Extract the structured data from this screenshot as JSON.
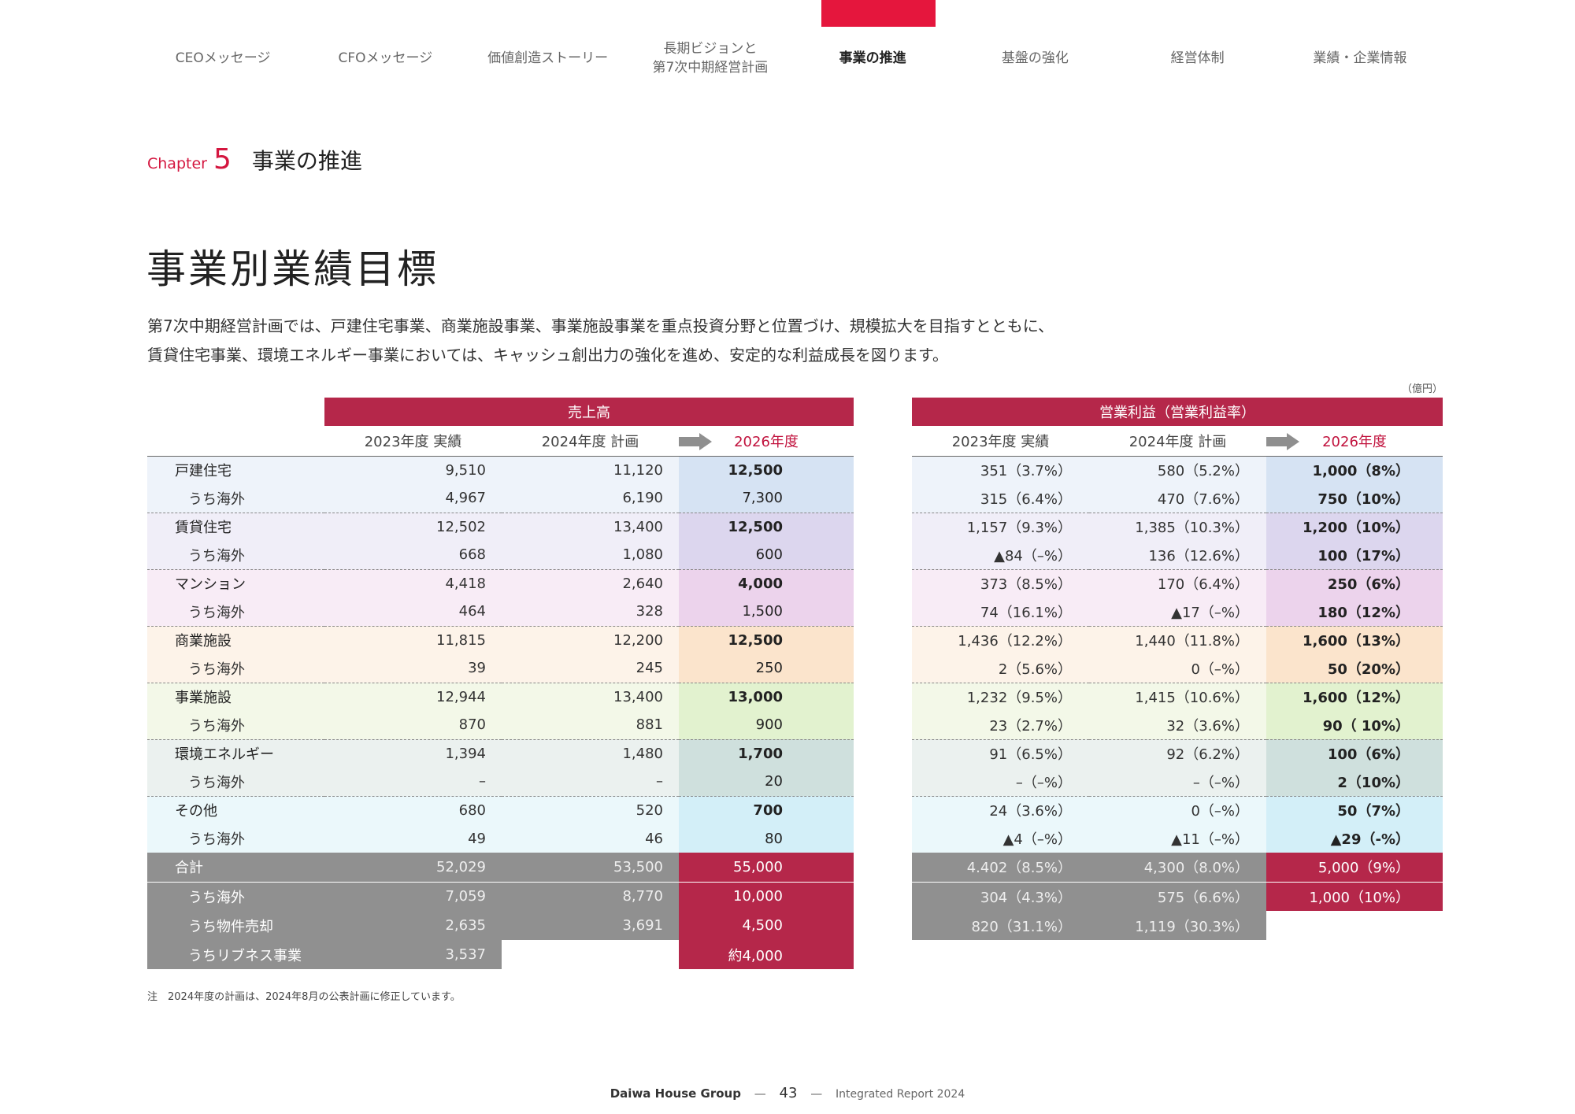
{
  "nav": {
    "items": [
      "CEOメッセージ",
      "CFOメッセージ",
      "価値創造ストーリー",
      "長期ビジョンと\n第7次中期経営計画",
      "事業の推進",
      "基盤の強化",
      "経営体制",
      "業績・企業情報"
    ],
    "active_index": 4,
    "active_color": "#e5163d"
  },
  "chapter": {
    "word": "Chapter",
    "number": "5",
    "title": "事業の推進"
  },
  "page_title": "事業別業績目標",
  "intro": [
    "第7次中期経営計画では、戸建住宅事業、商業施設事業、事業施設事業を重点投資分野と位置づけ、規模拡大を目指すとともに、",
    "賃貸住宅事業、環境エネルギー事業においては、キャッシュ創出力の強化を進め、安定的な利益成長を図ります。"
  ],
  "unit": "（億円）",
  "sales": {
    "header": "売上高",
    "cols": [
      "2023年度 実績",
      "2024年度 計画",
      "2026年度"
    ]
  },
  "profit": {
    "header": "営業利益（営業利益率）",
    "cols": [
      "2023年度 実績",
      "2024年度 計画",
      "2026年度"
    ]
  },
  "segments": [
    {
      "name": "戸建住宅",
      "sales": [
        "9,510",
        "11,120",
        "12,500"
      ],
      "profit": [
        "351（3.7%）",
        "580（5.2%）",
        "1,000（8%）"
      ],
      "sub": {
        "name": "うち海外",
        "sales": [
          "4,967",
          "6,190",
          "7,300"
        ],
        "profit": [
          "315（6.4%）",
          "470（7.6%）",
          "750（10%）"
        ]
      }
    },
    {
      "name": "賃貸住宅",
      "sales": [
        "12,502",
        "13,400",
        "12,500"
      ],
      "profit": [
        "1,157（9.3%）",
        "1,385（10.3%）",
        "1,200（10%）"
      ],
      "sub": {
        "name": "うち海外",
        "sales": [
          "668",
          "1,080",
          "600"
        ],
        "profit": [
          "▲84（–%）",
          "136（12.6%）",
          "100（17%）"
        ]
      }
    },
    {
      "name": "マンション",
      "sales": [
        "4,418",
        "2,640",
        "4,000"
      ],
      "profit": [
        "373（8.5%）",
        "170（6.4%）",
        "250（6%）"
      ],
      "sub": {
        "name": "うち海外",
        "sales": [
          "464",
          "328",
          "1,500"
        ],
        "profit": [
          "74（16.1%）",
          "▲17（–%）",
          "180（12%）"
        ]
      }
    },
    {
      "name": "商業施設",
      "sales": [
        "11,815",
        "12,200",
        "12,500"
      ],
      "profit": [
        "1,436（12.2%）",
        "1,440（11.8%）",
        "1,600（13%）"
      ],
      "sub": {
        "name": "うち海外",
        "sales": [
          "39",
          "245",
          "250"
        ],
        "profit": [
          "2（5.6%）",
          "0（–%）",
          "50（20%）"
        ]
      }
    },
    {
      "name": "事業施設",
      "sales": [
        "12,944",
        "13,400",
        "13,000"
      ],
      "profit": [
        "1,232（9.5%）",
        "1,415（10.6%）",
        "1,600（12%）"
      ],
      "sub": {
        "name": "うち海外",
        "sales": [
          "870",
          "881",
          "900"
        ],
        "profit": [
          "23（2.7%）",
          "32（3.6%）",
          "90（ 10%）"
        ]
      }
    },
    {
      "name": "環境エネルギー",
      "sales": [
        "1,394",
        "1,480",
        "1,700"
      ],
      "profit": [
        "91（6.5%）",
        "92（6.2%）",
        "100（6%）"
      ],
      "sub": {
        "name": "うち海外",
        "sales": [
          "–",
          "–",
          "20"
        ],
        "profit": [
          "–（–%）",
          "–（–%）",
          "2（10%）"
        ]
      }
    },
    {
      "name": "その他",
      "sales": [
        "680",
        "520",
        "700"
      ],
      "profit": [
        "24（3.6%）",
        "0（–%）",
        "50（7%）"
      ],
      "sub": {
        "name": "うち海外",
        "sales": [
          "49",
          "46",
          "80"
        ],
        "profit": [
          "▲4（–%）",
          "▲11（–%）",
          "▲29（-%）"
        ]
      }
    }
  ],
  "totals": [
    {
      "name": "合計",
      "sales": [
        "52,029",
        "53,500",
        "55,000"
      ],
      "profit": [
        "4.402（8.5%）",
        "4,300（8.0%）",
        "5,000（9%）"
      ]
    },
    {
      "name": "うち海外",
      "sales": [
        "7,059",
        "8,770",
        "10,000"
      ],
      "profit": [
        "304（4.3%）",
        "575（6.6%）",
        "1,000（10%）"
      ]
    },
    {
      "name": "うち物件売却",
      "sales": [
        "2,635",
        "3,691",
        "4,500"
      ],
      "profit": [
        "820（31.1%）",
        "1,119（30.3%）",
        ""
      ]
    },
    {
      "name": "うちリブネス事業",
      "sales": [
        "3,537",
        "",
        "約4,000"
      ],
      "profit": [
        "",
        "",
        ""
      ]
    }
  ],
  "note": "注　2024年度の計画は、2024年8月の公表計画に修正しています。",
  "footer": {
    "brand": "Daiwa House Group",
    "page": "43",
    "report": "Integrated Report 2024"
  },
  "colors": {
    "accent": "#e5163d",
    "band": "#b5274a",
    "total_gray": "#909090"
  }
}
